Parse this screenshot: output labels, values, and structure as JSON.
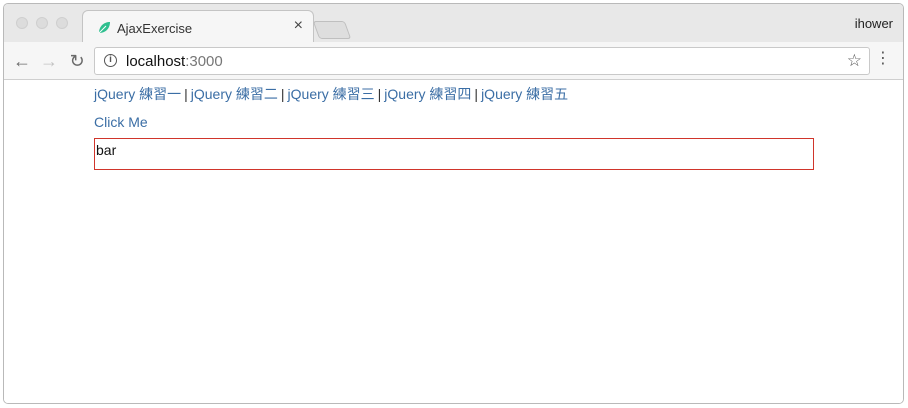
{
  "browser": {
    "tab_title": "AjaxExercise",
    "profile_name": "ihower",
    "url_host": "localhost",
    "url_port": ":3000",
    "favicon": "leaf-icon",
    "accent": "#3b6ea5"
  },
  "page": {
    "links": [
      "jQuery 練習一",
      "jQuery 練習二",
      "jQuery 練習三",
      "jQuery 練習四",
      "jQuery 練習五"
    ],
    "separator": "|",
    "click_me": "Click Me",
    "result_text": "bar",
    "result_border": "#d0352b"
  }
}
